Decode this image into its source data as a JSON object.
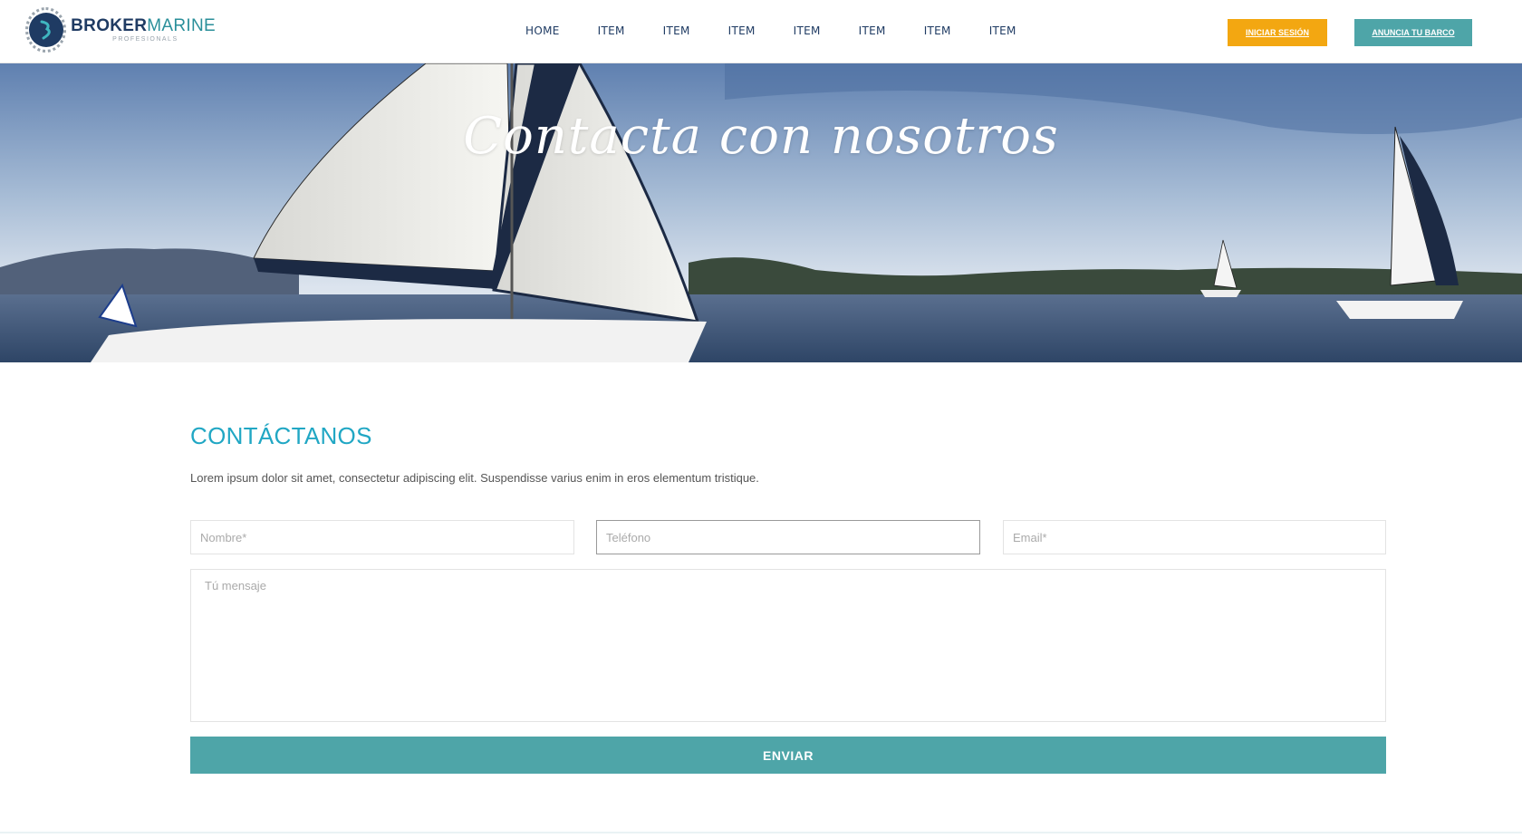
{
  "brand": {
    "name_part1": "BROKER",
    "name_part2": "MARINE",
    "tagline": "PROFESIONALS"
  },
  "nav": {
    "items": [
      "HOME",
      "ITEM",
      "ITEM",
      "ITEM",
      "ITEM",
      "ITEM",
      "ITEM",
      "ITEM"
    ]
  },
  "header_buttons": {
    "login": "INICIAR SESIÓN",
    "advertise": "ANUNCIA TU BARCO"
  },
  "hero": {
    "title": "Contacta con nosotros"
  },
  "contact": {
    "heading": "CONTÁCTANOS",
    "description": "Lorem ipsum dolor sit amet, consectetur adipiscing elit. Suspendisse varius enim in eros elementum tristique.",
    "name_placeholder": "Nombre*",
    "phone_placeholder": "Teléfono",
    "email_placeholder": "Email*",
    "message_placeholder": "Tú mensaje",
    "submit_label": "ENVIAR"
  },
  "colors": {
    "brand_navy": "#1f3b63",
    "brand_teal": "#4ea5a8",
    "heading_cyan": "#21a7c4",
    "login_orange": "#f3a711"
  }
}
